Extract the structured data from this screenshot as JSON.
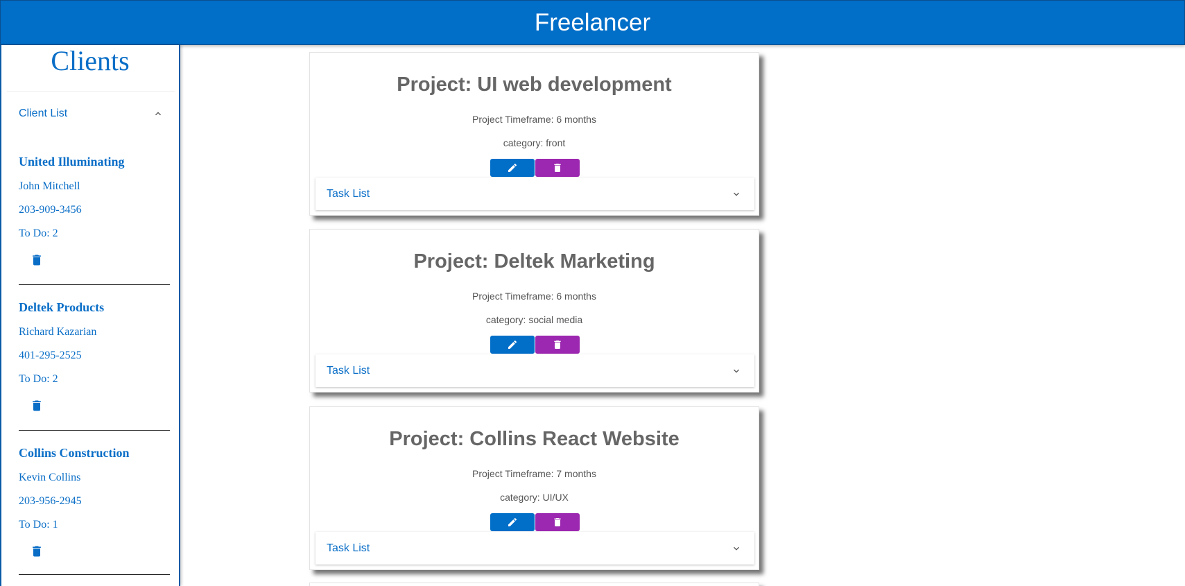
{
  "app": {
    "title": "Freelancer"
  },
  "sidebar": {
    "title": "Clients",
    "client_list_label": "Client List",
    "clients": [
      {
        "name": "United Illuminating",
        "contact": "John Mitchell",
        "phone": "203-909-3456",
        "todo": "To Do: 2"
      },
      {
        "name": "Deltek Products",
        "contact": "Richard Kazarian",
        "phone": "401-295-2525",
        "todo": "To Do: 2"
      },
      {
        "name": "Collins Construction",
        "contact": "Kevin Collins",
        "phone": "203-956-2945",
        "todo": "To Do: 1"
      }
    ]
  },
  "projects": [
    {
      "title": "Project: UI web development",
      "timeframe": "Project Timeframe: 6 months",
      "category": "category: front",
      "task_label": "Task List"
    },
    {
      "title": "Project: Deltek Marketing",
      "timeframe": "Project Timeframe: 6 months",
      "category": "category: social media",
      "task_label": "Task List"
    },
    {
      "title": "Project: Collins React Website",
      "timeframe": "Project Timeframe: 7 months",
      "category": "category: UI/UX",
      "task_label": "Task List"
    }
  ],
  "icons": {
    "edit": "pencil-icon",
    "delete": "trash-icon",
    "expand": "chevron-down-icon",
    "collapse": "chevron-up-icon"
  },
  "colors": {
    "primary": "#016ec8",
    "secondary": "#9c27b0",
    "title_gray": "#666666"
  }
}
